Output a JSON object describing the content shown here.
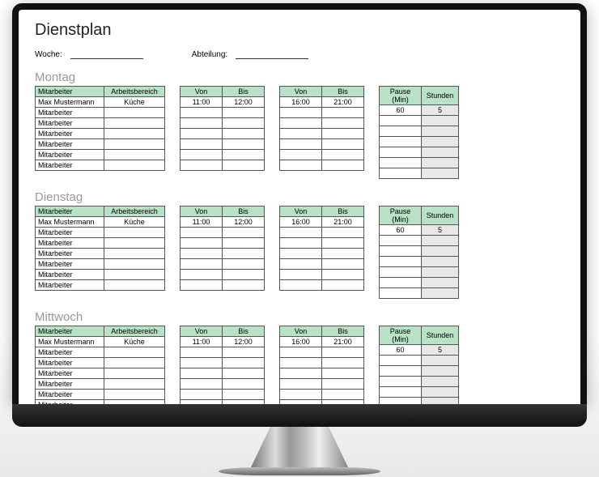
{
  "title": "Dienstplan",
  "meta": {
    "week_label": "Woche:",
    "dept_label": "Abteilung:",
    "week_value": "",
    "dept_value": ""
  },
  "headers": {
    "employee": "Mitarbeiter",
    "area": "Arbeitsbereich",
    "from": "Von",
    "to": "Bis",
    "pause": "Pause (Min)",
    "hours": "Stunden"
  },
  "emp_ph": "Mitarbeiter",
  "days": [
    {
      "name": "Montag",
      "rows": [
        {
          "emp": "Max Mustermann",
          "area": "Küche",
          "t1f": "11:00",
          "t1t": "12:00",
          "t2f": "16:00",
          "t2t": "21:00",
          "pause": "60",
          "hours": "5"
        },
        {
          "emp": "",
          "area": "",
          "t1f": "",
          "t1t": "",
          "t2f": "",
          "t2t": "",
          "pause": "",
          "hours": ""
        },
        {
          "emp": "",
          "area": "",
          "t1f": "",
          "t1t": "",
          "t2f": "",
          "t2t": "",
          "pause": "",
          "hours": ""
        },
        {
          "emp": "",
          "area": "",
          "t1f": "",
          "t1t": "",
          "t2f": "",
          "t2t": "",
          "pause": "",
          "hours": ""
        },
        {
          "emp": "",
          "area": "",
          "t1f": "",
          "t1t": "",
          "t2f": "",
          "t2t": "",
          "pause": "",
          "hours": ""
        },
        {
          "emp": "",
          "area": "",
          "t1f": "",
          "t1t": "",
          "t2f": "",
          "t2t": "",
          "pause": "",
          "hours": ""
        },
        {
          "emp": "",
          "area": "",
          "t1f": "",
          "t1t": "",
          "t2f": "",
          "t2t": "",
          "pause": "",
          "hours": ""
        }
      ]
    },
    {
      "name": "Dienstag",
      "rows": [
        {
          "emp": "Max Mustermann",
          "area": "Küche",
          "t1f": "11:00",
          "t1t": "12:00",
          "t2f": "16:00",
          "t2t": "21:00",
          "pause": "60",
          "hours": "5"
        },
        {
          "emp": "",
          "area": "",
          "t1f": "",
          "t1t": "",
          "t2f": "",
          "t2t": "",
          "pause": "",
          "hours": ""
        },
        {
          "emp": "",
          "area": "",
          "t1f": "",
          "t1t": "",
          "t2f": "",
          "t2t": "",
          "pause": "",
          "hours": ""
        },
        {
          "emp": "",
          "area": "",
          "t1f": "",
          "t1t": "",
          "t2f": "",
          "t2t": "",
          "pause": "",
          "hours": ""
        },
        {
          "emp": "",
          "area": "",
          "t1f": "",
          "t1t": "",
          "t2f": "",
          "t2t": "",
          "pause": "",
          "hours": ""
        },
        {
          "emp": "",
          "area": "",
          "t1f": "",
          "t1t": "",
          "t2f": "",
          "t2t": "",
          "pause": "",
          "hours": ""
        },
        {
          "emp": "",
          "area": "",
          "t1f": "",
          "t1t": "",
          "t2f": "",
          "t2t": "",
          "pause": "",
          "hours": ""
        }
      ]
    },
    {
      "name": "Mittwoch",
      "rows": [
        {
          "emp": "Max Mustermann",
          "area": "Küche",
          "t1f": "11:00",
          "t1t": "12:00",
          "t2f": "16:00",
          "t2t": "21:00",
          "pause": "60",
          "hours": "5"
        },
        {
          "emp": "",
          "area": "",
          "t1f": "",
          "t1t": "",
          "t2f": "",
          "t2t": "",
          "pause": "",
          "hours": ""
        },
        {
          "emp": "",
          "area": "",
          "t1f": "",
          "t1t": "",
          "t2f": "",
          "t2t": "",
          "pause": "",
          "hours": ""
        },
        {
          "emp": "",
          "area": "",
          "t1f": "",
          "t1t": "",
          "t2f": "",
          "t2t": "",
          "pause": "",
          "hours": ""
        },
        {
          "emp": "",
          "area": "",
          "t1f": "",
          "t1t": "",
          "t2f": "",
          "t2t": "",
          "pause": "",
          "hours": ""
        },
        {
          "emp": "",
          "area": "",
          "t1f": "",
          "t1t": "",
          "t2f": "",
          "t2t": "",
          "pause": "",
          "hours": ""
        },
        {
          "emp": "",
          "area": "",
          "t1f": "",
          "t1t": "",
          "t2f": "",
          "t2t": "",
          "pause": "",
          "hours": ""
        }
      ]
    }
  ]
}
